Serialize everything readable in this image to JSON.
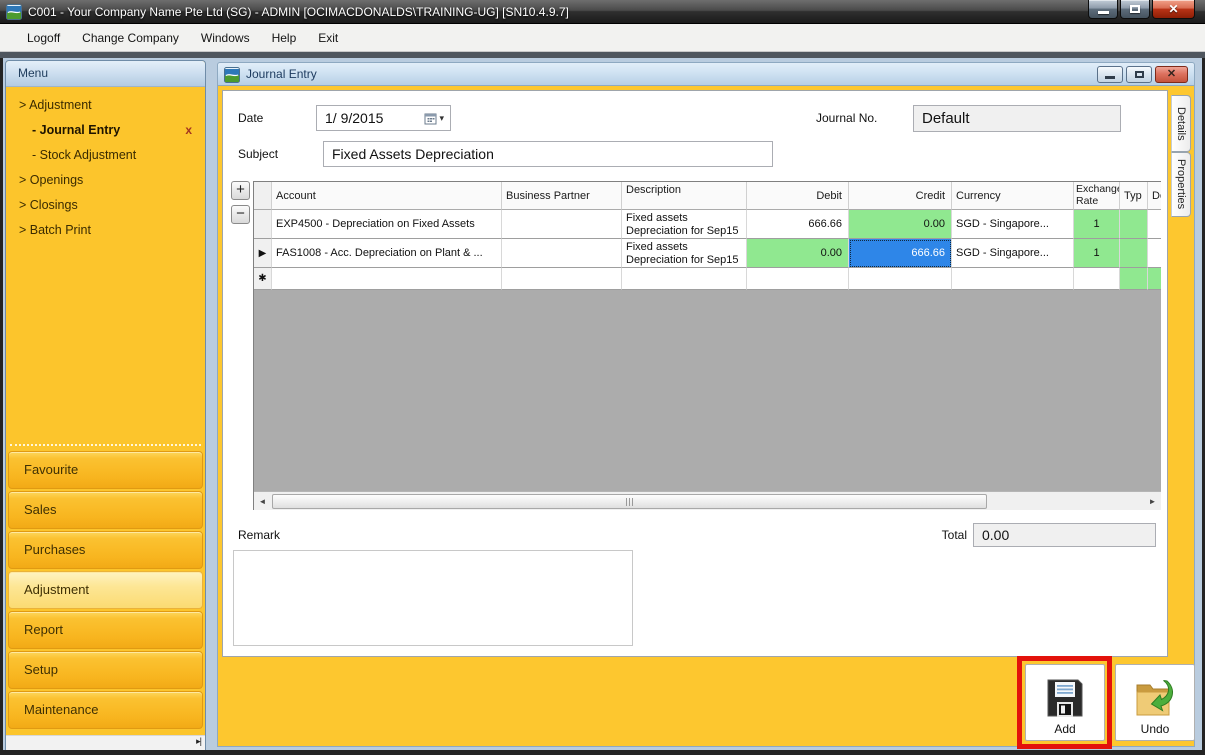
{
  "window": {
    "title": "C001 - Your Company Name Pte Ltd (SG) - ADMIN [OCIMACDONALDS\\TRAINING-UG] [SN10.4.9.7]",
    "menu": [
      "Logoff",
      "Change Company",
      "Windows",
      "Help",
      "Exit"
    ]
  },
  "sidebar": {
    "header": "Menu",
    "tree": [
      {
        "label": "> Adjustment"
      },
      {
        "label": "- Journal Entry",
        "close": "x"
      },
      {
        "label": "- Stock Adjustment"
      },
      {
        "label": "> Openings"
      },
      {
        "label": "> Closings"
      },
      {
        "label": "> Batch Print"
      }
    ],
    "nav_buttons": [
      "Favourite",
      "Sales",
      "Purchases",
      "Adjustment",
      "Report",
      "Setup",
      "Maintenance"
    ],
    "active_nav_button": "Adjustment"
  },
  "journal": {
    "title": "Journal Entry",
    "date_label": "Date",
    "date_value": "1/ 9/2015",
    "journal_no_label": "Journal No.",
    "journal_no_value": "Default",
    "subject_label": "Subject",
    "subject_value": "Fixed Assets Depreciation",
    "remark_label": "Remark",
    "remark_value": "",
    "total_label": "Total",
    "total_value": "0.00",
    "side_tabs": [
      "Details",
      "Properties"
    ],
    "buttons": {
      "add": "Add",
      "undo": "Undo"
    },
    "grid": {
      "columns": [
        "Account",
        "Business Partner",
        "Description",
        "Debit",
        "Credit",
        "Currency",
        "Exchange Rate",
        "Typ",
        "Docu"
      ],
      "rows": [
        {
          "indicator": "",
          "account": "EXP4500 - Depreciation on Fixed Assets",
          "business_partner": "",
          "description": "Fixed assets\nDepreciation for Sep15",
          "debit": "666.66",
          "credit": "0.00",
          "currency": "SGD - Singapore...",
          "exchange_rate": "1"
        },
        {
          "indicator": "▶",
          "account": "FAS1008 - Acc. Depreciation on Plant & ...",
          "business_partner": "",
          "description": "Fixed assets\nDepreciation for Sep15",
          "debit": "0.00",
          "credit": "666.66",
          "currency": "SGD - Singapore...",
          "exchange_rate": "1"
        }
      ],
      "new_row_indicator": "✱",
      "selected_cell": "row 2 Credit"
    }
  },
  "icons": {
    "window_close": "✕",
    "dropdown_caret": "▾",
    "scroll_left": "◄",
    "scroll_right": "►",
    "scroll_end": "▸|"
  },
  "colors": {
    "accent_yellow": "#FBC52C",
    "selection_blue": "#2E86E8",
    "cell_green": "#90E890",
    "annotation_red": "#E3120B",
    "titlebar_blue": "#CFE2F2"
  }
}
